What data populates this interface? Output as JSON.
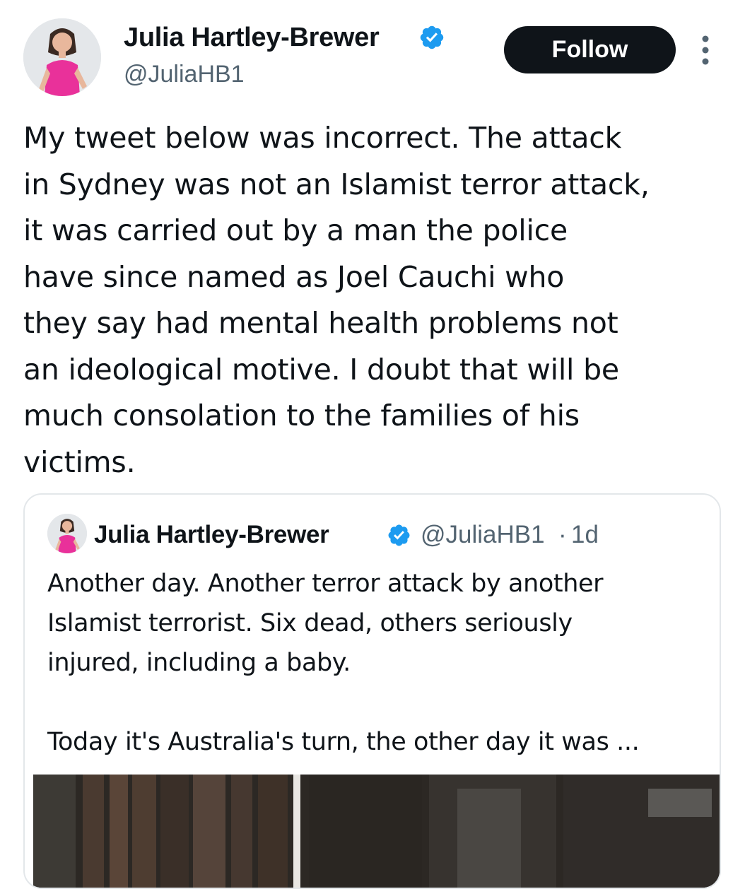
{
  "author": {
    "display_name": "Julia Hartley-Brewer",
    "handle": "@JuliaHB1",
    "verified": true
  },
  "actions": {
    "follow_label": "Follow"
  },
  "tweet": {
    "text": "My tweet below was incorrect. The attack\nin Sydney was not an Islamist terror attack,\nit was carried out by a man the police\nhave since named as Joel Cauchi who\nthey say had mental health problems not\nan ideological motive. I doubt that will be\nmuch consolation to the families of his\nvictims."
  },
  "quoted_tweet": {
    "display_name": "Julia Hartley-Brewer",
    "handle": "@JuliaHB1",
    "separator": "·",
    "timestamp": "1d",
    "verified": true,
    "text": "Another day. Another terror attack by another\nIslamist terrorist. Six dead, others seriously\ninjured, including a baby.\n\nToday it's Australia's turn, the other day it was ..."
  },
  "colors": {
    "verified_badge": "#1d9bf0",
    "follow_button_bg": "#0f1419",
    "secondary_text": "#536471",
    "card_border": "#e3e7ea"
  },
  "icons": {
    "verified": "verified-badge-icon",
    "more": "more-options-icon"
  }
}
